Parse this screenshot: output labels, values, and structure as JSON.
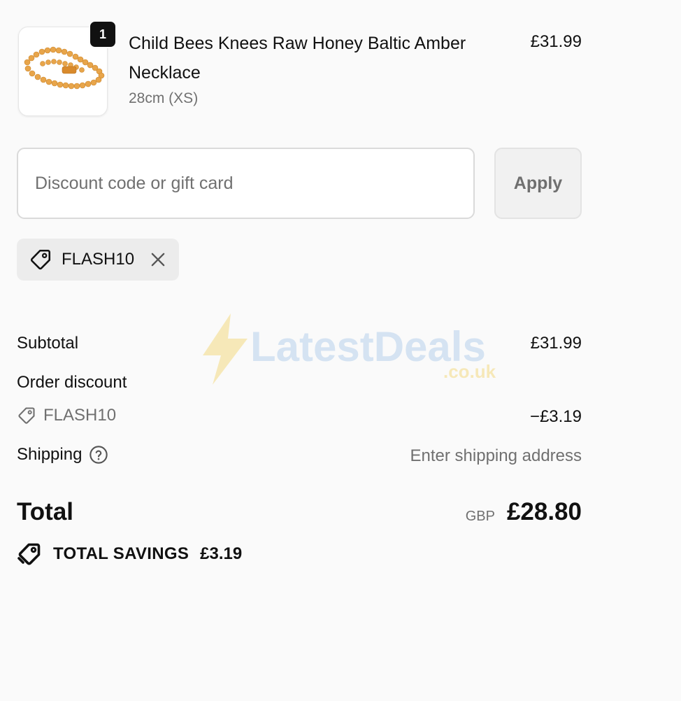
{
  "product": {
    "quantity": "1",
    "title": "Child Bees Knees Raw Honey Baltic Amber Necklace",
    "variant": "28cm (XS)",
    "price": "£31.99",
    "image_icon": "amber-necklace-image"
  },
  "discount": {
    "placeholder": "Discount code or gift card",
    "value": "",
    "apply_label": "Apply",
    "applied_code": "FLASH10"
  },
  "watermark": {
    "brand": "LatestDeals",
    "domain": ".co.uk"
  },
  "summary": {
    "subtotal_label": "Subtotal",
    "subtotal_value": "£31.99",
    "order_discount_label": "Order discount",
    "discount_code": "FLASH10",
    "discount_value": "−£3.19",
    "shipping_label": "Shipping",
    "shipping_value": "Enter shipping address",
    "total_label": "Total",
    "currency": "GBP",
    "total_value": "£28.80",
    "savings_label": "TOTAL SAVINGS",
    "savings_value": "£3.19"
  },
  "colors": {
    "background": "#fafafa",
    "text": "#111111",
    "muted": "#707070",
    "chip_bg": "#ececec",
    "amber": "#e8a03a"
  }
}
